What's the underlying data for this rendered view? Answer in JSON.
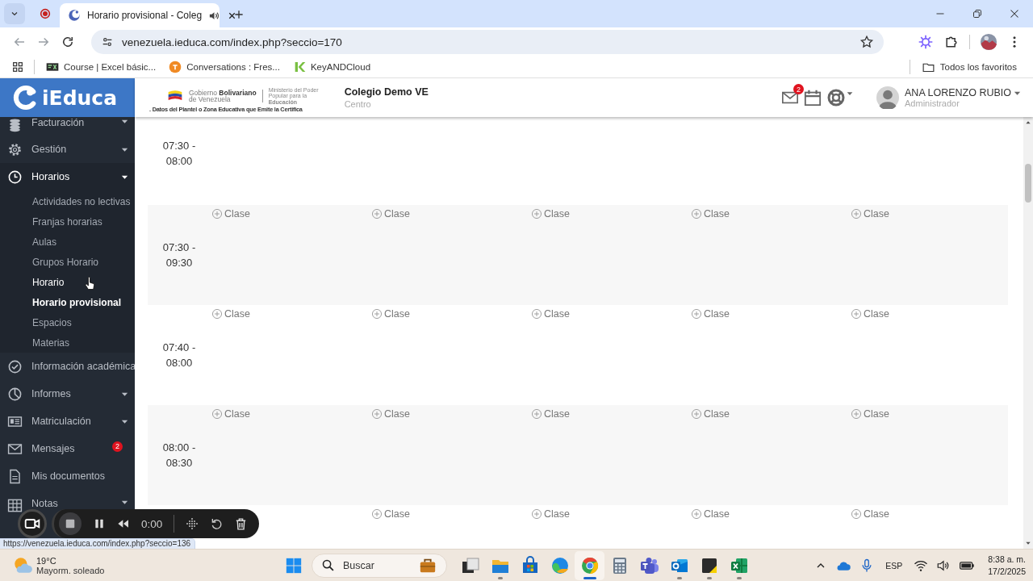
{
  "browser": {
    "tabs": [
      {
        "title": "Horario provisional - Coleg",
        "selected": true,
        "audio": true
      }
    ],
    "url": "venezuela.ieduca.com/index.php?seccio=170",
    "bookmarks": [
      {
        "label": "Course | Excel básic...",
        "kind": "course"
      },
      {
        "label": "Conversations : Fres...",
        "kind": "chat"
      },
      {
        "label": "KeyANDCloud",
        "kind": "key"
      }
    ],
    "all_bookmarks": "Todos los favoritos"
  },
  "header": {
    "logo": "iEduca",
    "banner": {
      "line1": "Gobierno **Bolivariano**",
      "line2": "de Venezuela",
      "ministry": "Ministerio del Poder Popular para la **Educación**",
      "caption": ". Datos del Plantel o Zona Educativa que Emite la Certifica"
    },
    "school": {
      "name": "Colegio Demo VE",
      "subtitle": "Centro"
    },
    "mail_count": "2",
    "user": {
      "name": "ANA LORENZO RUBIO",
      "role": "Administrador"
    }
  },
  "sidebar": {
    "items": [
      {
        "label": "Facturación",
        "kind": "coins",
        "expandable": true,
        "active": false
      },
      {
        "label": "Gestión",
        "kind": "gear",
        "expandable": true,
        "active": false
      },
      {
        "label": "Horarios",
        "kind": "clock",
        "expandable": true,
        "active": true,
        "expanded": true,
        "children": [
          {
            "label": "Actividades no lectivas",
            "selected": false,
            "hover": false
          },
          {
            "label": "Franjas horarias",
            "selected": false,
            "hover": false
          },
          {
            "label": "Aulas",
            "selected": false,
            "hover": false
          },
          {
            "label": "Grupos Horario",
            "selected": false,
            "hover": false
          },
          {
            "label": "Horario",
            "selected": false,
            "hover": true
          },
          {
            "label": "Horario provisional",
            "selected": true,
            "hover": false
          },
          {
            "label": "Espacios",
            "selected": false,
            "hover": false
          },
          {
            "label": "Materias",
            "selected": false,
            "hover": false
          }
        ]
      },
      {
        "label": "Información académica",
        "kind": "check",
        "expandable": false,
        "active": false
      },
      {
        "label": "Informes",
        "kind": "pie",
        "expandable": true,
        "active": false
      },
      {
        "label": "Matriculación",
        "kind": "card",
        "expandable": true,
        "active": false
      },
      {
        "label": "Mensajes",
        "kind": "mail",
        "expandable": false,
        "active": false,
        "badge": "2"
      },
      {
        "label": "Mis documentos",
        "kind": "doc",
        "expandable": false,
        "active": false
      },
      {
        "label": "Notas",
        "kind": "grid",
        "expandable": true,
        "active": false
      }
    ]
  },
  "schedule": {
    "rows": [
      {
        "time": "07:30 - 08:00",
        "kind": "top"
      },
      {
        "time": "07:30 - 09:30",
        "kind": "full",
        "slots": [
          "Clase",
          "Clase",
          "Clase",
          "Clase",
          "Clase"
        ]
      },
      {
        "time": "07:40 - 08:00",
        "kind": "full",
        "slots": [
          "Clase",
          "Clase",
          "Clase",
          "Clase",
          "Clase"
        ]
      },
      {
        "time": "08:00 - 08:30",
        "kind": "full",
        "slots": [
          "Clase",
          "Clase",
          "Clase",
          "Clase",
          "Clase"
        ]
      },
      {
        "kind": "bottom",
        "slots": [
          "Clase",
          "Clase",
          "Clase",
          "Clase"
        ]
      }
    ]
  },
  "recorder": {
    "time": "0:00"
  },
  "status_url": "https://venezuela.ieduca.com/index.php?seccio=136",
  "taskbar": {
    "weather": {
      "temp": "19°C",
      "desc": "Mayorm. soleado"
    },
    "search": {
      "placeholder": "Buscar"
    },
    "apps": [
      {
        "kind": "taskview",
        "running": false,
        "selected": false
      },
      {
        "kind": "explorer",
        "running": true,
        "selected": false
      },
      {
        "kind": "store",
        "running": false,
        "selected": false
      },
      {
        "kind": "edge",
        "running": false,
        "selected": false
      },
      {
        "kind": "chrome",
        "running": true,
        "selected": true
      },
      {
        "kind": "calculator",
        "running": false,
        "selected": false
      },
      {
        "kind": "teams",
        "running": false,
        "selected": false
      },
      {
        "kind": "outlook",
        "running": true,
        "selected": false
      },
      {
        "kind": "notes",
        "running": true,
        "selected": false
      },
      {
        "kind": "excel",
        "running": true,
        "selected": false
      }
    ],
    "tray": {
      "language": "ESP",
      "time": "8:38 a. m.",
      "date": "17/2/2025"
    }
  }
}
